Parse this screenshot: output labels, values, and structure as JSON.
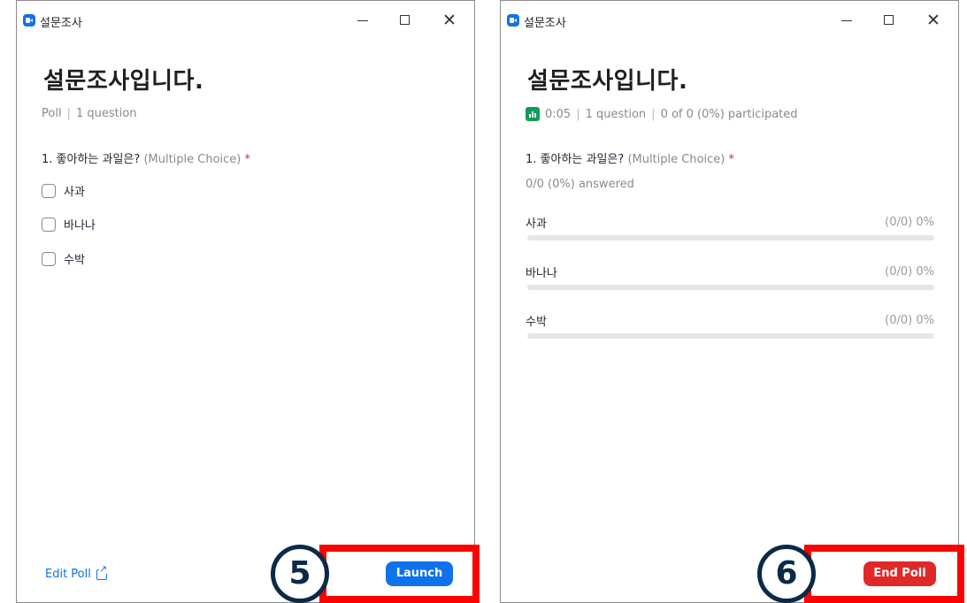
{
  "colors": {
    "accent": "#0e72ed",
    "danger": "#e02828",
    "highlight": "#ff0000",
    "badge": "#0b2948",
    "poll_icon": "#0f9d58"
  },
  "left_window": {
    "title": "설문조사",
    "heading": "설문조사입니다.",
    "meta": {
      "type": "Poll",
      "separator": "|",
      "count": "1 question"
    },
    "question": {
      "text": "1. 좋아하는 과일은?",
      "type": "(Multiple Choice)",
      "required": "*"
    },
    "options": [
      "사과",
      "바나나",
      "수박"
    ],
    "edit_link": "Edit Poll",
    "launch_button": "Launch"
  },
  "right_window": {
    "title": "설문조사",
    "heading": "설문조사입니다.",
    "meta": {
      "timer": "0:05",
      "separator": "|",
      "count": "1 question",
      "participation": "0 of 0 (0%) participated"
    },
    "question": {
      "text": "1. 좋아하는 과일은?",
      "type": "(Multiple Choice)",
      "required": "*"
    },
    "answered": "0/0 (0%) answered",
    "results": [
      {
        "label": "사과",
        "count": "(0/0) 0%",
        "fraction": 0
      },
      {
        "label": "바나나",
        "count": "(0/0) 0%",
        "fraction": 0
      },
      {
        "label": "수박",
        "count": "(0/0) 0%",
        "fraction": 0
      }
    ],
    "end_button": "End Poll"
  },
  "annotations": {
    "step_5": "5",
    "step_6": "6"
  },
  "icons": {
    "app": "zoom-camera-icon",
    "minimize": "minimize-icon",
    "maximize": "maximize-icon",
    "close": "close-icon",
    "external": "external-link-icon",
    "poll_bars": "bar-chart-icon",
    "checkbox": "checkbox-icon"
  }
}
